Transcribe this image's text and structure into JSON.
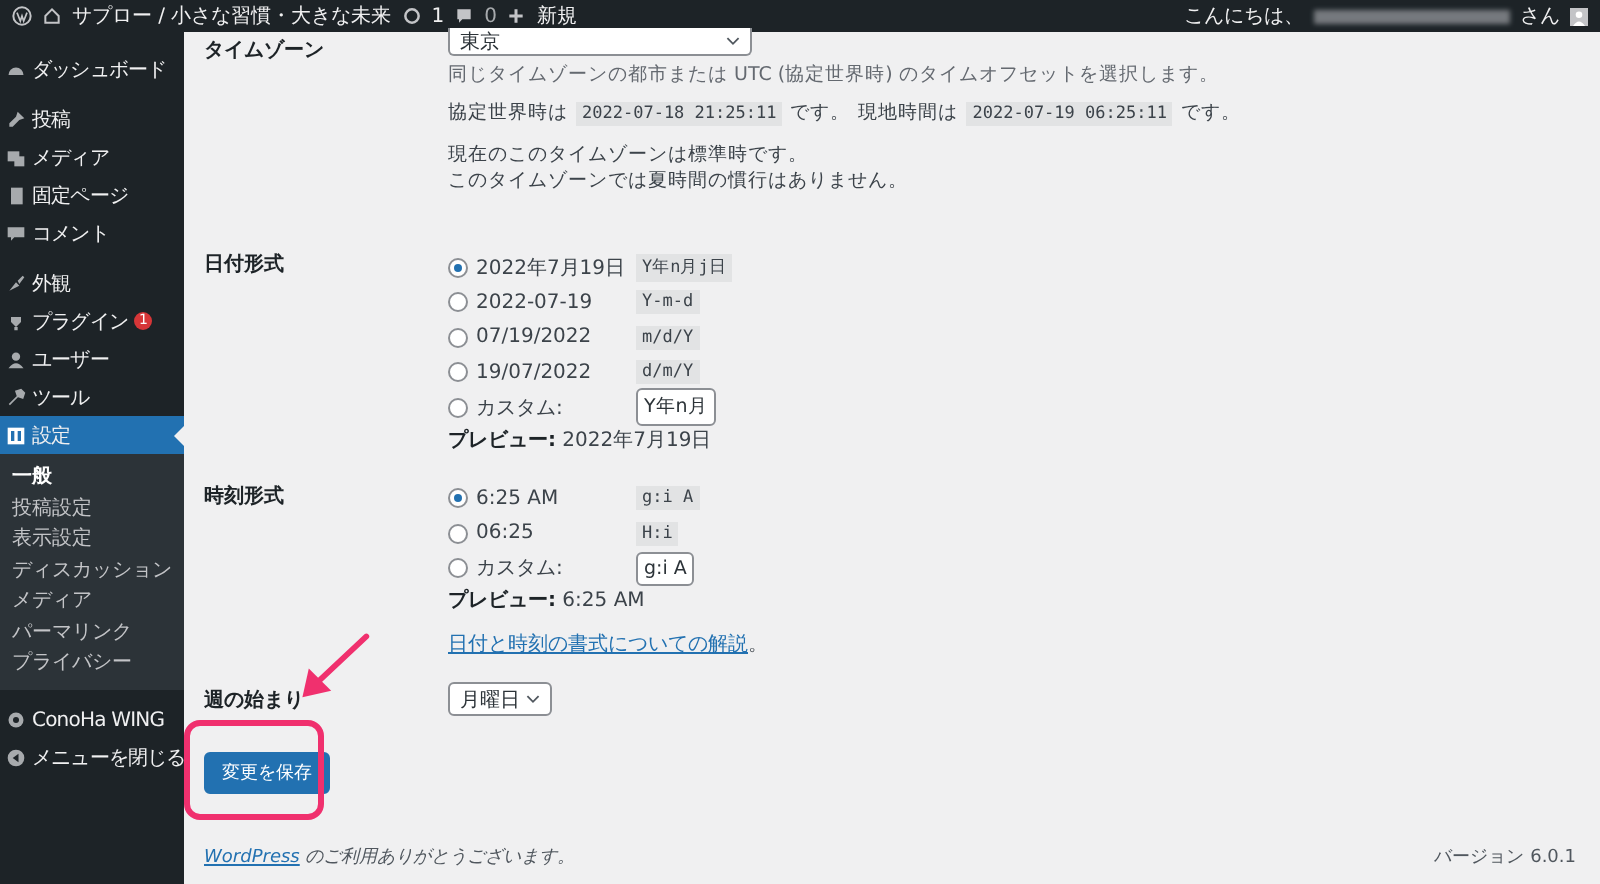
{
  "admin_bar": {
    "site_title": "サプロー / 小さな習慣・大きな未来",
    "updates": "1",
    "comments": "0",
    "new": "新規",
    "greeting": "こんにちは、",
    "greeting_suffix": "さん"
  },
  "sidebar": {
    "groups": [
      {
        "items": [
          {
            "label": "ダッシュボード",
            "selected": false
          }
        ]
      },
      {
        "items": [
          {
            "label": "投稿",
            "selected": false
          },
          {
            "label": "メディア",
            "selected": false
          },
          {
            "label": "固定ページ",
            "selected": false
          },
          {
            "label": "コメント",
            "selected": false
          }
        ]
      },
      {
        "items": [
          {
            "label": "外観",
            "selected": false
          },
          {
            "label": "プラグイン",
            "selected": false,
            "badge": "1"
          },
          {
            "label": "ユーザー",
            "selected": false
          },
          {
            "label": "ツール",
            "selected": false
          },
          {
            "label": "設定",
            "selected": true,
            "children": [
              {
                "label": "一般",
                "selected": true
              },
              {
                "label": "投稿設定",
                "selected": false
              },
              {
                "label": "表示設定",
                "selected": false
              },
              {
                "label": "ディスカッション",
                "selected": false
              },
              {
                "label": "メディア",
                "selected": false
              },
              {
                "label": "パーマリンク",
                "selected": false
              },
              {
                "label": "プライバシー",
                "selected": false
              }
            ]
          }
        ]
      },
      {
        "items": [
          {
            "label": "ConoHa WING",
            "selected": false
          },
          {
            "label": "メニューを閉じる",
            "selected": false
          }
        ]
      }
    ]
  },
  "timezone": {
    "label": "タイムゾーン",
    "value": "東京",
    "description": "同じタイムゾーンの都市または UTC (協定世界時) のタイムオフセットを選択します。",
    "utc_label": "協定世界時は",
    "utc_time": "2022-07-18 21:25:11",
    "utc_suffix": "です。",
    "local_label": "現地時間は",
    "local_time": "2022-07-19 06:25:11",
    "local_suffix": "です。",
    "notes": [
      "現在のこのタイムゾーンは標準時です。",
      "このタイムゾーンでは夏時間の慣行はありません。"
    ]
  },
  "date_format": {
    "label": "日付形式",
    "options": [
      {
        "kind": "preset",
        "label": "2022年7月19日",
        "code": "Y年n月j日",
        "selected": true
      },
      {
        "kind": "preset",
        "label": "2022-07-19",
        "code": "Y-m-d",
        "selected": false
      },
      {
        "kind": "preset",
        "label": "07/19/2022",
        "code": "m/d/Y",
        "selected": false
      },
      {
        "kind": "preset",
        "label": "19/07/2022",
        "code": "d/m/Y",
        "selected": false
      },
      {
        "kind": "custom",
        "label": "カスタム:",
        "code": "Y年n月",
        "selected": false
      }
    ],
    "preview_label": "プレビュー:",
    "preview_value": "2022年7月19日"
  },
  "time_format": {
    "label": "時刻形式",
    "options": [
      {
        "kind": "preset",
        "label": "6:25 AM",
        "code": "g:i A",
        "selected": true
      },
      {
        "kind": "preset",
        "label": "06:25",
        "code": "H:i",
        "selected": false
      },
      {
        "kind": "custom",
        "label": "カスタム:",
        "code": "g:i A",
        "selected": false
      }
    ],
    "preview_label": "プレビュー:",
    "preview_value": "6:25 AM",
    "help_link": "日付と時刻の書式についての解説",
    "help_suffix": "。"
  },
  "week_start": {
    "label": "週の始まり",
    "value": "月曜日"
  },
  "save_button": "変更を保存",
  "footer": {
    "link": "WordPress",
    "text": "のご利用ありがとうございます。",
    "version": "バージョン 6.0.1"
  }
}
